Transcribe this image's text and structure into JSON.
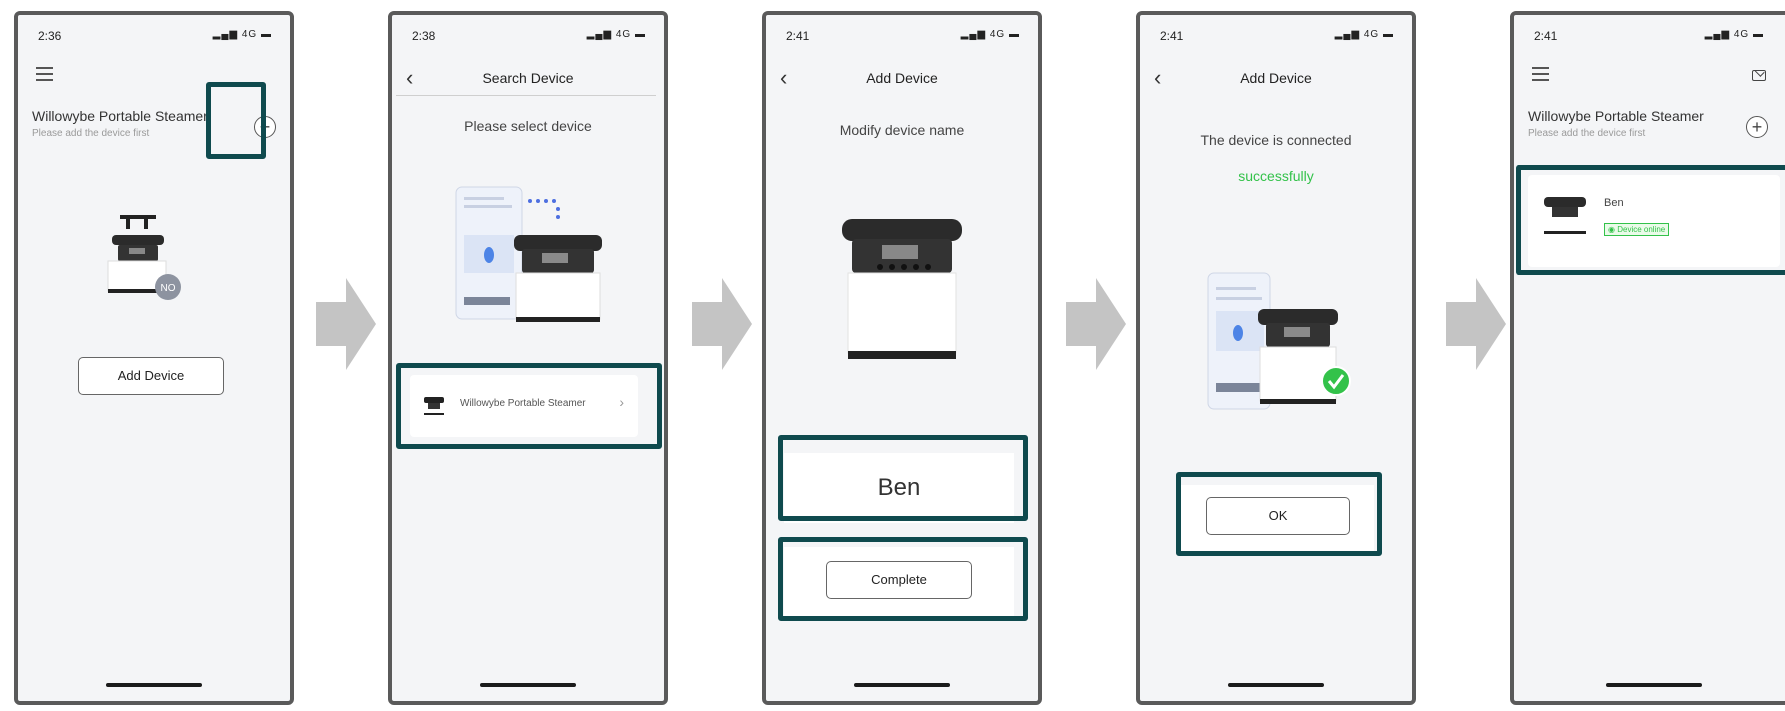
{
  "colors": {
    "highlight": "#0f4a4e",
    "success": "#33c24a",
    "arrow": "#c4c4c4",
    "frame": "#5a5a5a"
  },
  "screen1": {
    "time": "2:36",
    "signal": "4G",
    "title": "Willowybe Portable Steamer",
    "subtitle": "Please add the device first",
    "offline_badge": "NO",
    "add_button": "Add Device",
    "plus_icon": "+"
  },
  "screen2": {
    "time": "2:38",
    "signal": "4G",
    "nav_title": "Search Device",
    "prompt": "Please select device",
    "device_name": "Willowybe Portable Steamer",
    "chevron": "›"
  },
  "screen3": {
    "time": "2:41",
    "signal": "4G",
    "nav_title": "Add Device",
    "prompt": "Modify device name",
    "name_value": "Ben",
    "complete_button": "Complete"
  },
  "screen4": {
    "time": "2:41",
    "signal": "4G",
    "nav_title": "Add Device",
    "line1": "The device is connected",
    "line2": "successfully",
    "ok_button": "OK"
  },
  "screen5": {
    "time": "2:41",
    "signal": "4G",
    "title": "Willowybe Portable Steamer",
    "subtitle": "Please add the device first",
    "device_name": "Ben",
    "status": "Device online",
    "plus_icon": "+"
  }
}
